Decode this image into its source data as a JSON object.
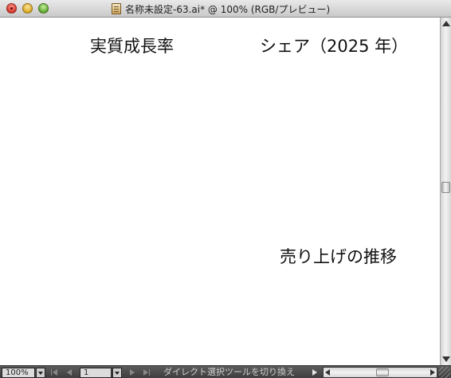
{
  "window": {
    "title": "名称未設定-63.ai* @ 100% (RGB/プレビュー)"
  },
  "canvas": {
    "labels": {
      "growth": "実質成長率",
      "share": "シェア（2025 年）",
      "sales": "売り上げの推移"
    }
  },
  "statusbar": {
    "zoom": "100%",
    "page": "1",
    "tool_status": "ダイレクト選択ツールを切り換え"
  },
  "icons": {
    "document": "illustrator-document-icon",
    "close": "close-window-icon",
    "minimize": "minimize-window-icon",
    "zoom": "zoom-window-icon"
  }
}
